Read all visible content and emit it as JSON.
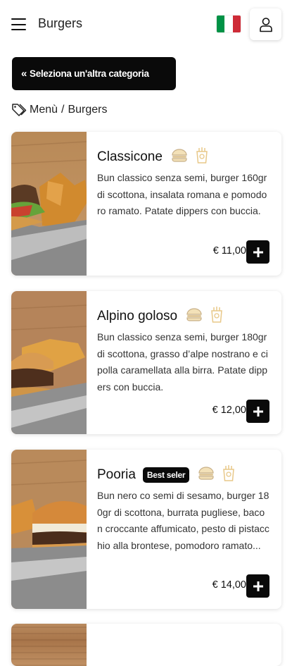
{
  "header": {
    "title": "Burgers",
    "flag_colors": [
      "#009246",
      "#ffffff",
      "#ce2b37"
    ]
  },
  "category_button": {
    "label": "Seleziona un'altra categoria"
  },
  "breadcrumb": {
    "root": "Menù",
    "separator": "/",
    "current": "Burgers"
  },
  "products": [
    {
      "name": "Classicone",
      "badge": "",
      "description": "Bun classico senza semi, burger 160gr di scottona, insalata romana e pomodoro ramato. Patate dippers con buccia.",
      "price": "€ 11,00"
    },
    {
      "name": "Alpino goloso",
      "badge": "",
      "description": "Bun classico senza semi, burger 180gr di scottona, grasso d’alpe nostrano e cipolla caramellata alla birra. Patate dippers con buccia.",
      "price": "€ 12,00"
    },
    {
      "name": "Pooria",
      "badge": "Best seler",
      "description": "Bun nero co semi di sesamo, burger 180gr di scottona, burrata pugliese, bacon croccante affumicato, pesto di pistacchio alla brontese, pomodoro ramato...",
      "price": "€ 14,00"
    }
  ],
  "colors": {
    "accent": "#0a0a0a",
    "icon_tint": "#e8c889"
  }
}
